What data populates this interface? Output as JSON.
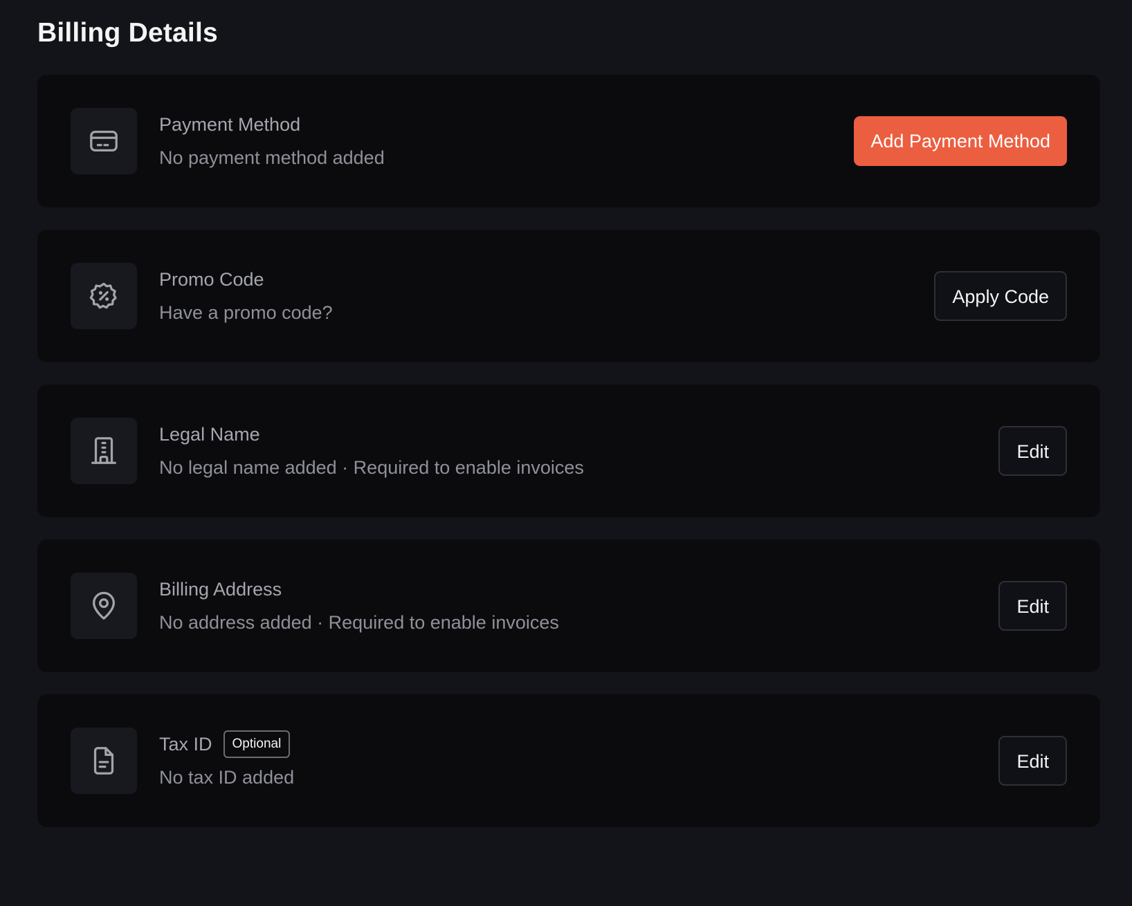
{
  "page": {
    "title": "Billing Details"
  },
  "sections": [
    {
      "icon": "credit-card-icon",
      "label": "Payment Method",
      "description": "No payment method added",
      "button_label": "Add Payment Method",
      "button_style": "primary"
    },
    {
      "icon": "discount-badge-icon",
      "label": "Promo Code",
      "description": "Have a promo code?",
      "button_label": "Apply Code",
      "button_style": "outline"
    },
    {
      "icon": "building-icon",
      "label": "Legal Name",
      "description": "No legal name added · Required to enable invoices",
      "button_label": "Edit",
      "button_style": "outline"
    },
    {
      "icon": "map-pin-icon",
      "label": "Billing Address",
      "description": "No address added · Required to enable invoices",
      "button_label": "Edit",
      "button_style": "outline"
    },
    {
      "icon": "document-icon",
      "label": "Tax ID",
      "badge": "Optional",
      "description": "No tax ID added",
      "button_label": "Edit",
      "button_style": "outline"
    }
  ],
  "colors": {
    "background": "#13141a",
    "card": "#0b0b0e",
    "accent": "#ec5e40"
  }
}
